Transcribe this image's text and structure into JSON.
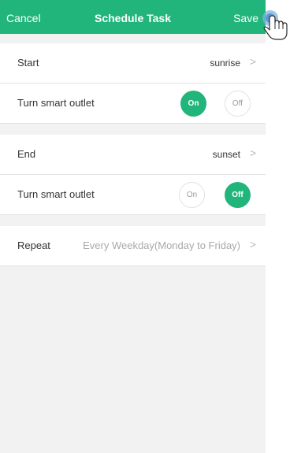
{
  "header": {
    "cancel": "Cancel",
    "title": "Schedule Task",
    "save": "Save"
  },
  "start": {
    "label": "Start",
    "value": "sunrise",
    "outlet_label": "Turn smart outlet",
    "on": "On",
    "off": "Off",
    "state": "on"
  },
  "end": {
    "label": "End",
    "value": "sunset",
    "outlet_label": "Turn smart outlet",
    "on": "On",
    "off": "Off",
    "state": "off"
  },
  "repeat": {
    "label": "Repeat",
    "value": "Every Weekday(Monday to Friday)"
  },
  "chevron": ">",
  "colors": {
    "accent": "#21b57b",
    "background": "#f2f2f2"
  }
}
